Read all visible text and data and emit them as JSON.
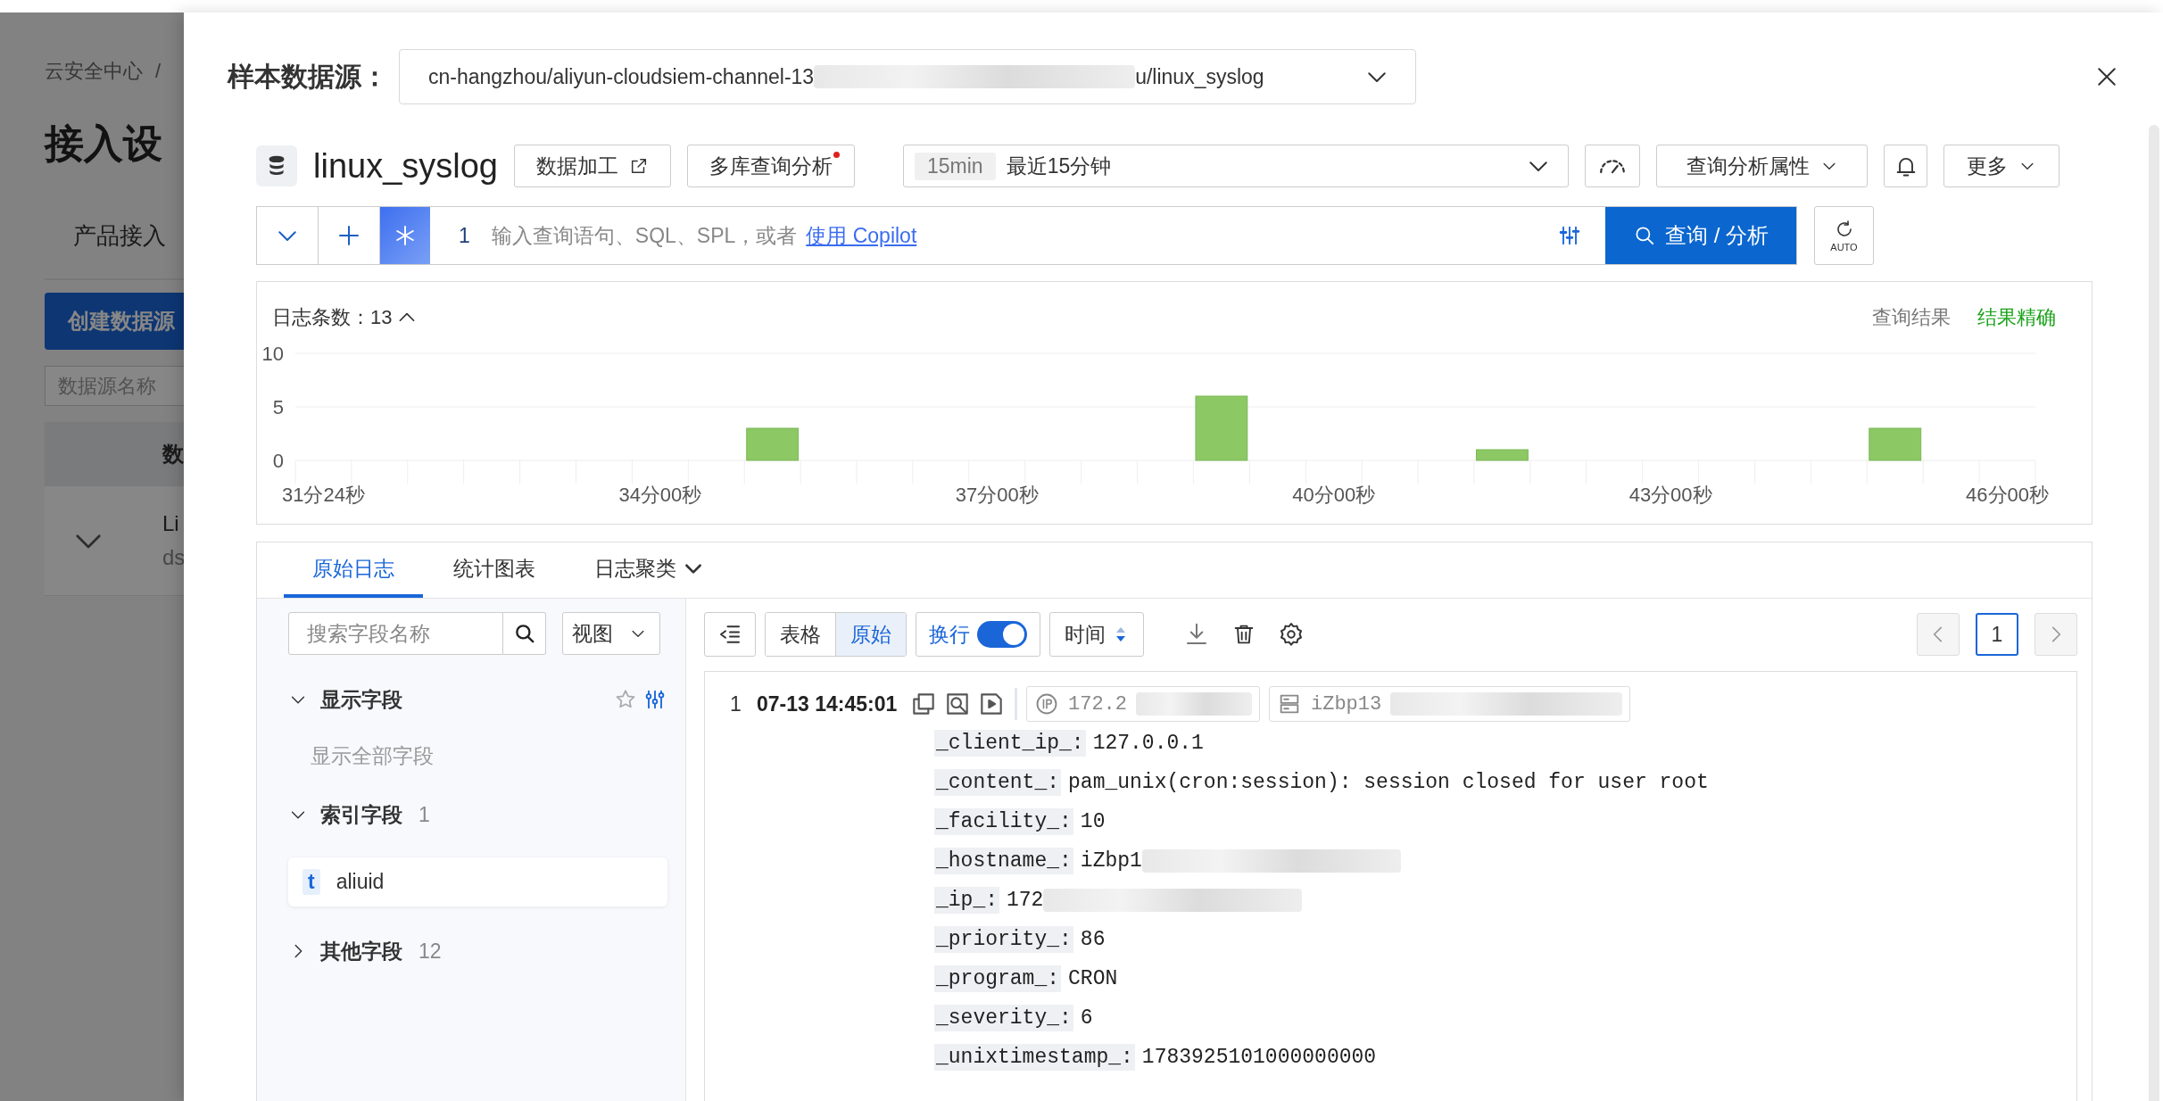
{
  "background_page": {
    "breadcrumb": [
      "云安全中心",
      "/"
    ],
    "title": "接入设",
    "tab": "产品接入",
    "create_button": "创建数据源",
    "search": {
      "placeholder": "数据源名称"
    },
    "table_header": "数",
    "row": {
      "expanded": false,
      "name": "Li",
      "detail": "ds"
    }
  },
  "source_picker": {
    "label": "样本数据源：",
    "prefix": "cn-hangzhou/aliyun-cloudsiem-channel-13",
    "suffix": "u/linux_syslog"
  },
  "logstore": {
    "name": "linux_syslog",
    "tools": [
      {
        "label": "数据加工",
        "kind": "external"
      },
      {
        "label": "多库查询分析",
        "kind": "new_dot"
      }
    ],
    "time_range": {
      "badge": "15min",
      "label": "最近15分钟"
    },
    "properties": "查询分析属性",
    "more": "更多"
  },
  "query": {
    "line": "1",
    "hint": "输入查询语句、SQL、SPL，或者",
    "link": "使用 Copilot",
    "search_button": "查询 / 分析",
    "refresh": "AUTO"
  },
  "histogram": {
    "count": "日志条数：13",
    "status_label": "查询结果",
    "status": "结果精确",
    "chart_data": {
      "type": "bar",
      "ylim": [
        0,
        10
      ],
      "yticks": [
        0,
        5,
        10
      ],
      "categories": [
        "31分24秒",
        null,
        null,
        null,
        null,
        null,
        "34分00秒",
        null,
        null,
        null,
        null,
        null,
        "37分00秒",
        null,
        null,
        null,
        null,
        null,
        "40分00秒",
        null,
        null,
        null,
        null,
        null,
        "43分00秒",
        null,
        null,
        null,
        null,
        null,
        "46分00秒"
      ],
      "values": [
        null,
        null,
        null,
        null,
        null,
        null,
        null,
        null,
        3,
        null,
        null,
        null,
        null,
        null,
        null,
        null,
        6,
        null,
        null,
        null,
        null,
        1,
        null,
        null,
        null,
        null,
        null,
        null,
        3,
        null,
        null
      ]
    }
  },
  "tabs": [
    {
      "label": "原始日志",
      "selected": true,
      "kind": "plain"
    },
    {
      "label": "统计图表",
      "selected": false,
      "kind": "plain"
    },
    {
      "label": "日志聚类",
      "selected": false,
      "kind": "menu"
    }
  ],
  "fields_panel": {
    "search": {
      "placeholder": "搜索字段名称"
    },
    "view": "视图",
    "groups": [
      {
        "kind": "display",
        "title": "显示字段",
        "expanded": true,
        "hint": "显示全部字段"
      },
      {
        "kind": "indexed",
        "title": "索引字段",
        "count": "1",
        "expanded": true,
        "fields": [
          {
            "type": "t",
            "name": "aliuid"
          }
        ]
      },
      {
        "kind": "other",
        "title": "其他字段",
        "count": "12",
        "expanded": false
      }
    ]
  },
  "toolbar": {
    "views": [
      {
        "label": "表格",
        "selected": false
      },
      {
        "label": "原始",
        "selected": true
      }
    ],
    "wrap": {
      "label": "换行",
      "on": true
    },
    "sort": "时间",
    "page": "1"
  },
  "logs": [
    {
      "index": "1",
      "time": "07-13 14:45:01",
      "chips": [
        {
          "kind": "ip",
          "text": "172.2",
          "redacted": true
        },
        {
          "kind": "host",
          "text": "iZbp13",
          "redacted": true
        }
      ],
      "fields": [
        {
          "key": "_client_ip_:",
          "value": "127.0.0.1",
          "redacted": false
        },
        {
          "key": "_content_:",
          "value": "pam_unix(cron:session): session closed for user root",
          "redacted": false
        },
        {
          "key": "_facility_:",
          "value": "10",
          "redacted": false
        },
        {
          "key": "_hostname_:",
          "value": "iZbp1",
          "redacted": true
        },
        {
          "key": "_ip_:",
          "value": "172",
          "redacted": true
        },
        {
          "key": "_priority_:",
          "value": "86",
          "redacted": false
        },
        {
          "key": "_program_:",
          "value": "CRON",
          "redacted": false
        },
        {
          "key": "_severity_:",
          "value": "6",
          "redacted": false
        },
        {
          "key": "_unixtimestamp_:",
          "value": "1783925101000000000",
          "redacted": false
        }
      ]
    }
  ]
}
